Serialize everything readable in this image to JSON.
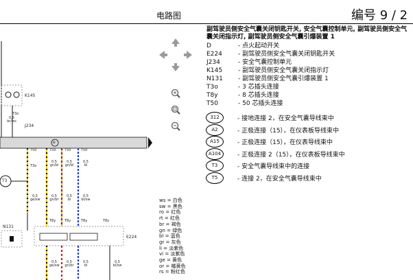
{
  "header": {
    "title": "电路图",
    "number": "编号 9 / 2"
  },
  "schematic": {
    "bus_label": "J234",
    "bus_node": "e",
    "ground_node": "T3",
    "comp_k145": "K145",
    "comp_n131": "N131",
    "comp_e224": "E224",
    "connectors": [
      "T3o",
      "T3o",
      "T50",
      "T50",
      "T50",
      "T50",
      "T8y",
      "T8y",
      "T8y",
      "T8y"
    ],
    "upper_wires": [
      {
        "size": "0,5",
        "color": "br/ws"
      },
      {
        "size": "0,5",
        "color": "gn/bl"
      },
      {
        "size": "0,5",
        "color": "gn/bl"
      },
      {
        "size": "0,5",
        "color": "bl"
      }
    ],
    "lower_wires": [
      {
        "size": "0,5",
        "color": "ge/sw"
      },
      {
        "size": "0,5",
        "color": "gn/br"
      },
      {
        "size": "0,5",
        "color": "bl"
      },
      {
        "size": "0,5",
        "color": "bl/sw"
      }
    ],
    "bottom_wires": [
      {
        "size": "0,5",
        "color": "ge/sw"
      },
      {
        "size": "0,5",
        "color": "gn/br"
      },
      {
        "size": "0,5",
        "color": "bl"
      },
      {
        "size": "0,5",
        "color": "bl/sw"
      }
    ],
    "wire_colors": {
      "yellow": "#f2d21b",
      "purple": "#7a2a8c",
      "blue": "#1f3fd1",
      "black": "#111111",
      "red": "#c81e1e",
      "bus": "#d9d9d9"
    }
  },
  "nav": {
    "icons": [
      "arrow-up-icon",
      "arrow-left-icon",
      "arrow-right-icon",
      "arrow-down-icon",
      "zoom-in-icon",
      "zoom-fit-icon",
      "zoom-out-icon"
    ]
  },
  "legend": {
    "title": "副驾驶员侧安全气囊关闭钥匙开关, 安全气囊控制单元, 副驾驶员侧安全气囊关闭指示灯, 副驾驶员侧安全气囊引爆装置 1",
    "items": [
      {
        "code": "D",
        "desc": "点火起动开关"
      },
      {
        "code": "E224",
        "desc": "副驾驶员侧安全气囊关闭钥匙开关"
      },
      {
        "code": "J234",
        "desc": "安全气囊控制单元"
      },
      {
        "code": "K145",
        "desc": "副驾驶员侧安全气囊关闭指示灯"
      },
      {
        "code": "N131",
        "desc": "副驾驶员侧安全气囊引爆装置 1"
      },
      {
        "code": "T3o",
        "desc": "3 芯插头连接"
      },
      {
        "code": "T8y",
        "desc": "8 芯插头连接"
      },
      {
        "code": "T50",
        "desc": "50 芯插头连接"
      }
    ],
    "connections": [
      {
        "code": "312",
        "desc": "接地连接 2，在安全气囊导线束中"
      },
      {
        "code": "A2",
        "desc": "正极连接（15），在仪表板导线束中"
      },
      {
        "code": "A15",
        "desc": "正极连接（15），在仪表导线束中"
      },
      {
        "code": "A104",
        "desc": "正极连接 2（15），在仪表板导线束中"
      },
      {
        "code": "T3",
        "desc": "安全气囊导线束中的连接"
      },
      {
        "code": "T5",
        "desc": "连接 2，在安全气囊导线束中"
      }
    ]
  },
  "color_key": [
    {
      "abbr": "ws",
      "name": "白色"
    },
    {
      "abbr": "sw",
      "name": "黑色"
    },
    {
      "abbr": "ro",
      "name": "红色"
    },
    {
      "abbr": "rt",
      "name": "红色"
    },
    {
      "abbr": "br",
      "name": "褐色"
    },
    {
      "abbr": "gn",
      "name": "绿色"
    },
    {
      "abbr": "bl",
      "name": "蓝色"
    },
    {
      "abbr": "gr",
      "name": "灰色"
    },
    {
      "abbr": "li",
      "name": "淡紫色"
    },
    {
      "abbr": "vi",
      "name": "淡紫色"
    },
    {
      "abbr": "ge",
      "name": "黄色"
    },
    {
      "abbr": "or",
      "name": "橘黄色"
    },
    {
      "abbr": "rs",
      "name": "粉红色"
    }
  ]
}
